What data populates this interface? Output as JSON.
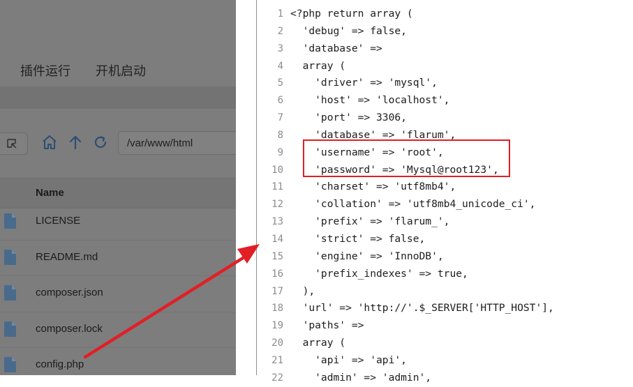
{
  "tabs": {
    "plugin_run": "插件运行",
    "startup": "开机启动"
  },
  "toolbar": {
    "path_value": "/var/www/html"
  },
  "file_table": {
    "name_header": "Name",
    "files": [
      "LICENSE",
      "README.md",
      "composer.json",
      "composer.lock",
      "config.php"
    ]
  },
  "editor": {
    "lines": [
      {
        "n": "1",
        "code": "<?php return array ("
      },
      {
        "n": "2",
        "code": "  'debug' => false,"
      },
      {
        "n": "3",
        "code": "  'database' =>"
      },
      {
        "n": "4",
        "code": "  array ("
      },
      {
        "n": "5",
        "code": "    'driver' => 'mysql',"
      },
      {
        "n": "6",
        "code": "    'host' => 'localhost',"
      },
      {
        "n": "7",
        "code": "    'port' => 3306,"
      },
      {
        "n": "8",
        "code": "    'database' => 'flarum',"
      },
      {
        "n": "9",
        "code": "    'username' => 'root',"
      },
      {
        "n": "10",
        "code": "    'password' => 'Mysql@root123',"
      },
      {
        "n": "11",
        "code": "    'charset' => 'utf8mb4',"
      },
      {
        "n": "12",
        "code": "    'collation' => 'utf8mb4_unicode_ci',"
      },
      {
        "n": "13",
        "code": "    'prefix' => 'flarum_',"
      },
      {
        "n": "14",
        "code": "    'strict' => false,"
      },
      {
        "n": "15",
        "code": "    'engine' => 'InnoDB',"
      },
      {
        "n": "16",
        "code": "    'prefix_indexes' => true,"
      },
      {
        "n": "17",
        "code": "  ),"
      },
      {
        "n": "18",
        "code": "  'url' => 'http://'.$_SERVER['HTTP_HOST'],"
      },
      {
        "n": "19",
        "code": "  'paths' =>"
      },
      {
        "n": "20",
        "code": "  array ("
      },
      {
        "n": "21",
        "code": "    'api' => 'api',"
      },
      {
        "n": "22",
        "code": "    'admin' => 'admin',"
      }
    ]
  },
  "colors": {
    "highlight": "#e01e24",
    "arrow": "#e21f26",
    "file_icon": "#4a6a8c",
    "nav_icon": "#2d4d75"
  },
  "icons": [
    "select-icon",
    "home-icon",
    "up-arrow-icon",
    "refresh-icon",
    "file-icon"
  ]
}
